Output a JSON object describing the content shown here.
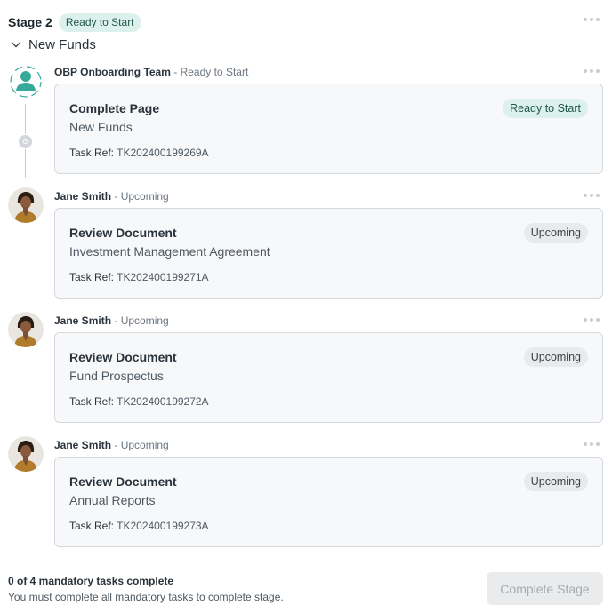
{
  "stage": {
    "title": "Stage 2",
    "status": "Ready to Start"
  },
  "group": {
    "label": "New Funds",
    "chevron_icon": "chevron-down-icon"
  },
  "tasks": [
    {
      "assignee": "OBP Onboarding Team",
      "separator": " - ",
      "assignee_status": "Ready to Start",
      "avatar": "team-icon",
      "title": "Complete Page",
      "subtitle": "New Funds",
      "ref_label": "Task Ref:",
      "ref": "TK202400199269A",
      "badge": "Ready to Start"
    },
    {
      "assignee": "Jane Smith",
      "separator": " - ",
      "assignee_status": "Upcoming",
      "avatar": "user-photo",
      "title": "Review Document",
      "subtitle": "Investment Management Agreement",
      "ref_label": "Task Ref:",
      "ref": "TK202400199271A",
      "badge": "Upcoming"
    },
    {
      "assignee": "Jane Smith",
      "separator": " - ",
      "assignee_status": "Upcoming",
      "avatar": "user-photo",
      "title": "Review Document",
      "subtitle": "Fund Prospectus",
      "ref_label": "Task Ref:",
      "ref": "TK202400199272A",
      "badge": "Upcoming"
    },
    {
      "assignee": "Jane Smith",
      "separator": " - ",
      "assignee_status": "Upcoming",
      "avatar": "user-photo",
      "title": "Review Document",
      "subtitle": "Annual Reports",
      "ref_label": "Task Ref:",
      "ref": "TK202400199273A",
      "badge": "Upcoming"
    }
  ],
  "footer": {
    "progress": "0 of 4 mandatory tasks complete",
    "hint": "You must complete all mandatory tasks to complete stage.",
    "button": "Complete Stage"
  },
  "colors": {
    "ready_badge_bg": "#dcf1ec",
    "ready_badge_text": "#24584a",
    "upcoming_badge_bg": "#e8eaec",
    "team_icon": "#35a99a",
    "card_bg": "#f7f8f9",
    "card_border": "#d5d9dd"
  }
}
